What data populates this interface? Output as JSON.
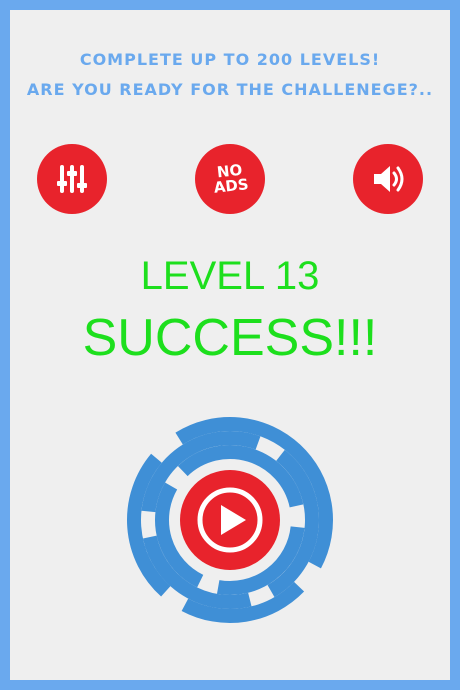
{
  "header": {
    "line1": "COMPLETE UP TO 200 LEVELS!",
    "line2": "ARE YOU READY FOR THE CHALLENEGE?.."
  },
  "buttons": {
    "settings_icon": "sliders-icon",
    "noads_line1": "NO",
    "noads_line2": "ADS",
    "sound_icon": "speaker-icon",
    "play_icon": "play-icon"
  },
  "status": {
    "level": "LEVEL 13",
    "result": "SUCCESS!!!"
  },
  "colors": {
    "background_border": "#6aa9ee",
    "panel": "#efefef",
    "button_red": "#e8232c",
    "success_green": "#1ddf1d",
    "ring_blue": "#3f8fd6"
  }
}
